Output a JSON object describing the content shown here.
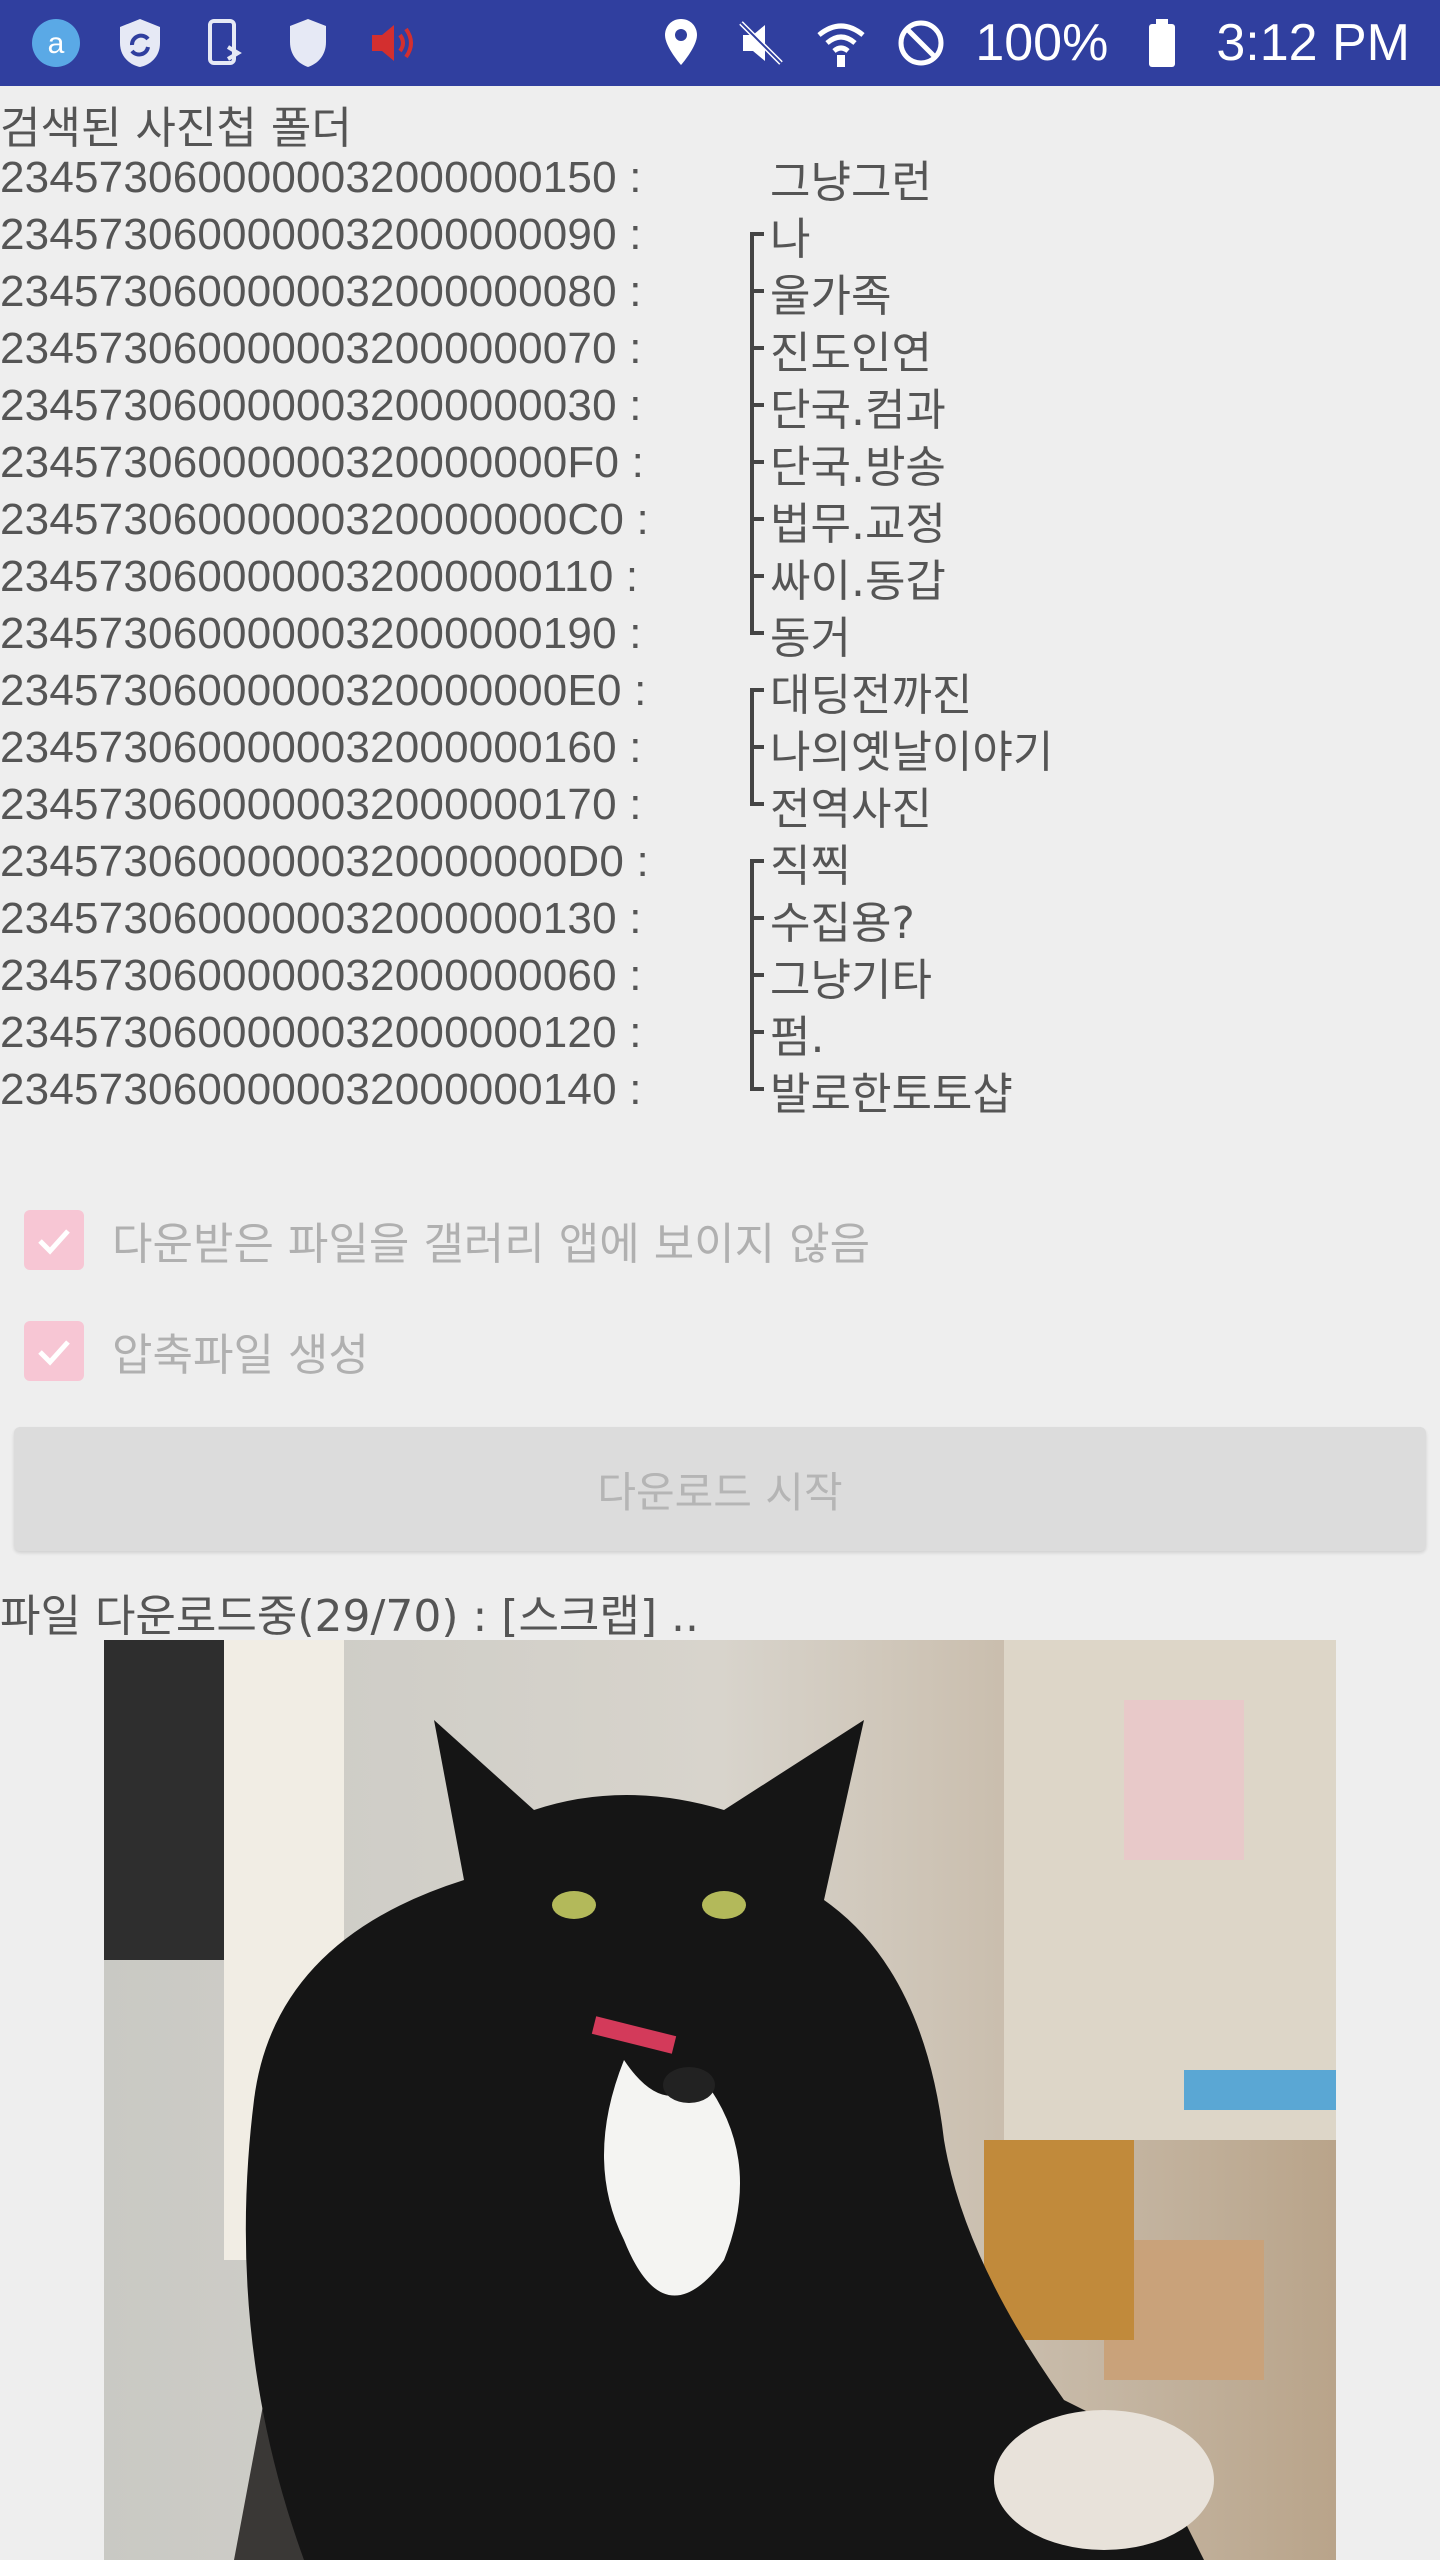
{
  "status_bar": {
    "battery": "100%",
    "time": "3:12 PM",
    "left_icons": [
      "app-a-icon",
      "shield-sync-icon",
      "phone-sync-icon",
      "shield-icon",
      "volume-red-icon"
    ],
    "right_icons": [
      "location-icon",
      "mute-icon",
      "wifi-call-icon",
      "block-icon",
      "battery-icon"
    ]
  },
  "folders": {
    "heading": "검색된 사진첩 폴더",
    "items": [
      {
        "id": "2345730600000032000000150 :",
        "name": "그냥그런",
        "tree": "none"
      },
      {
        "id": "2345730600000032000000090 :",
        "name": "나",
        "tree": "start"
      },
      {
        "id": "2345730600000032000000080 :",
        "name": "울가족",
        "tree": "mid"
      },
      {
        "id": "2345730600000032000000070 :",
        "name": "진도인연",
        "tree": "mid"
      },
      {
        "id": "2345730600000032000000030 :",
        "name": "단국.컴과",
        "tree": "mid"
      },
      {
        "id": "23457306000000320000000F0 :",
        "name": "단국.방송",
        "tree": "mid"
      },
      {
        "id": "23457306000000320000000C0 :",
        "name": "법무.교정",
        "tree": "mid"
      },
      {
        "id": "2345730600000032000000110 :",
        "name": "싸이.동갑",
        "tree": "mid"
      },
      {
        "id": "2345730600000032000000190 :",
        "name": "동거",
        "tree": "end"
      },
      {
        "id": "23457306000000320000000E0 :",
        "name": "대딩전까진",
        "tree": "start"
      },
      {
        "id": "2345730600000032000000160 :",
        "name": "나의옛날이야기",
        "tree": "mid"
      },
      {
        "id": "2345730600000032000000170 :",
        "name": "전역사진",
        "tree": "end"
      },
      {
        "id": "23457306000000320000000D0 :",
        "name": "직찍",
        "tree": "start"
      },
      {
        "id": "2345730600000032000000130 :",
        "name": "수집용?",
        "tree": "mid"
      },
      {
        "id": "2345730600000032000000060 :",
        "name": "그냥기타",
        "tree": "mid"
      },
      {
        "id": "2345730600000032000000120 :",
        "name": "펌.",
        "tree": "mid"
      },
      {
        "id": "2345730600000032000000140 :",
        "name": "발로한토토샵",
        "tree": "end"
      }
    ]
  },
  "options": {
    "hide_in_gallery": {
      "label": "다운받은 파일을 갤러리 앱에 보이지 않음",
      "checked": true
    },
    "create_zip": {
      "label": "압축파일 생성",
      "checked": true
    }
  },
  "download_button": {
    "label": "다운로드 시작",
    "enabled": false
  },
  "progress": {
    "text": "파일 다운로드중(29/70) : [스크랩] .."
  },
  "colors": {
    "status_bar": "#303f9f",
    "checkbox_accent": "#f7c6d4",
    "background": "#eeeeee"
  }
}
